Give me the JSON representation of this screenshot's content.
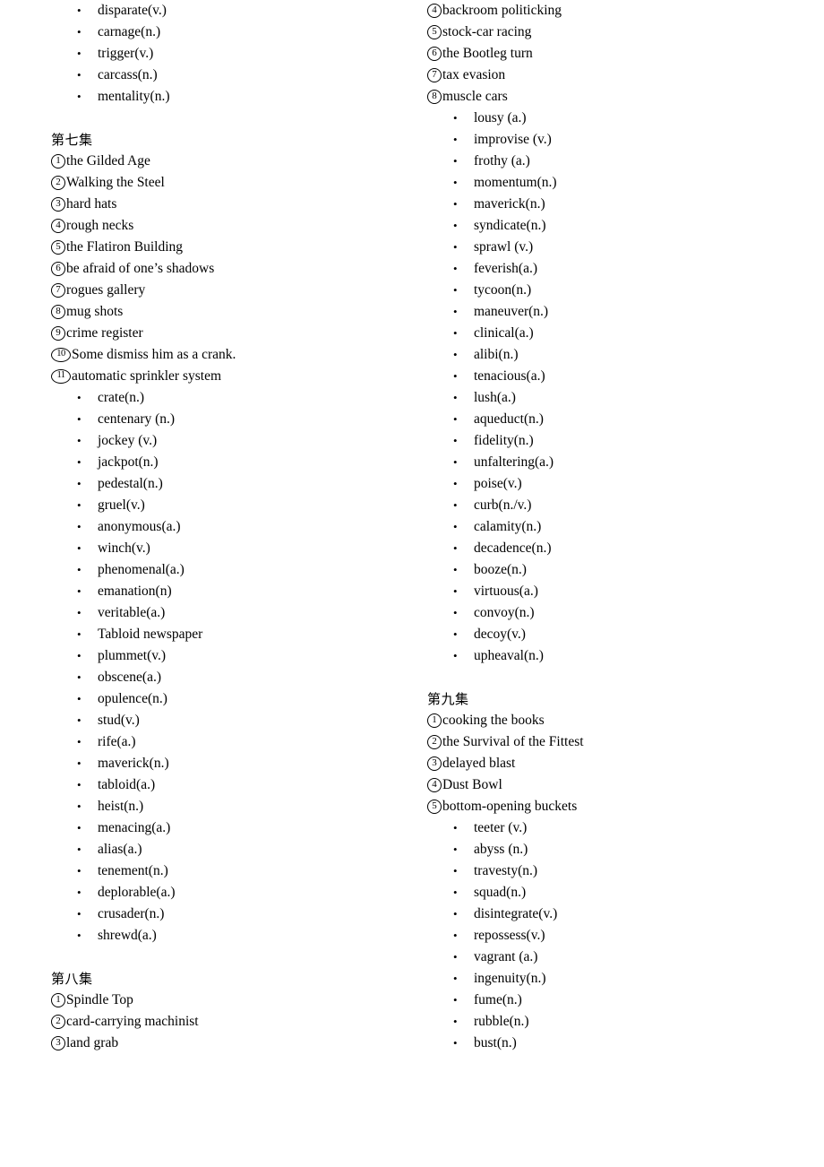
{
  "document": {
    "type": "vocabulary-list",
    "text_color": "#000000",
    "background_color": "#ffffff",
    "bullet_glyph": "•"
  },
  "columns": [
    {
      "name": "left-column",
      "blocks": [
        {
          "kind": "bullets",
          "items": [
            "disparate(v.)",
            "carnage(n.)",
            "trigger(v.)",
            "carcass(n.)",
            "mentality(n.)"
          ]
        },
        {
          "kind": "spacer"
        },
        {
          "kind": "heading",
          "text": "第七集"
        },
        {
          "kind": "numbered",
          "items": [
            {
              "marker": "1",
              "text": "the Gilded Age"
            },
            {
              "marker": "2",
              "text": "Walking the Steel"
            },
            {
              "marker": "3",
              "text": "hard hats"
            },
            {
              "marker": "4",
              "text": "rough necks"
            },
            {
              "marker": "5",
              "text": "the Flatiron Building"
            },
            {
              "marker": "6",
              "text": "be afraid of one’s shadows"
            },
            {
              "marker": "7",
              "text": "rogues gallery"
            },
            {
              "marker": "8",
              "text": "mug shots"
            },
            {
              "marker": "9",
              "text": "crime register"
            },
            {
              "marker": "10",
              "text": "Some dismiss him as a crank."
            },
            {
              "marker": "11",
              "text": "automatic sprinkler system"
            }
          ]
        },
        {
          "kind": "bullets",
          "items": [
            "crate(n.)",
            "centenary (n.)",
            "jockey (v.)",
            "jackpot(n.)",
            "pedestal(n.)",
            "gruel(v.)",
            "anonymous(a.)",
            "winch(v.)",
            "phenomenal(a.)",
            "emanation(n)",
            "veritable(a.)",
            "Tabloid newspaper",
            "plummet(v.)",
            "obscene(a.)",
            "opulence(n.)",
            "stud(v.)",
            "rife(a.)",
            "maverick(n.)",
            "tabloid(a.)",
            "heist(n.)",
            "menacing(a.)",
            "alias(a.)",
            "tenement(n.)",
            "deplorable(a.)",
            "crusader(n.)",
            "shrewd(a.)"
          ]
        },
        {
          "kind": "spacer"
        },
        {
          "kind": "heading",
          "text": "第八集"
        },
        {
          "kind": "numbered",
          "items": [
            {
              "marker": "1",
              "text": "Spindle Top"
            },
            {
              "marker": "2",
              "text": "card-carrying machinist"
            },
            {
              "marker": "3",
              "text": "land grab"
            }
          ]
        }
      ]
    },
    {
      "name": "right-column",
      "blocks": [
        {
          "kind": "numbered",
          "items": [
            {
              "marker": "4",
              "text": "backroom politicking"
            },
            {
              "marker": "5",
              "text": "stock-car racing"
            },
            {
              "marker": "6",
              "text": "the Bootleg turn"
            },
            {
              "marker": "7",
              "text": "tax evasion"
            },
            {
              "marker": "8",
              "text": "muscle cars"
            }
          ]
        },
        {
          "kind": "bullets",
          "items": [
            "lousy (a.)",
            "improvise (v.)",
            "frothy (a.)",
            "momentum(n.)",
            "maverick(n.)",
            "syndicate(n.)",
            "sprawl (v.)",
            "feverish(a.)",
            "tycoon(n.)",
            "maneuver(n.)",
            "clinical(a.)",
            "alibi(n.)",
            "tenacious(a.)",
            "lush(a.)",
            "aqueduct(n.)",
            "fidelity(n.)",
            "unfaltering(a.)",
            "poise(v.)",
            "curb(n./v.)",
            "calamity(n.)",
            "decadence(n.)",
            "booze(n.)",
            "virtuous(a.)",
            "convoy(n.)",
            "decoy(v.)",
            "upheaval(n.)"
          ]
        },
        {
          "kind": "spacer"
        },
        {
          "kind": "heading",
          "text": "第九集"
        },
        {
          "kind": "numbered",
          "items": [
            {
              "marker": "1",
              "text": "cooking the books"
            },
            {
              "marker": "2",
              "text": "the Survival of the Fittest"
            },
            {
              "marker": "3",
              "text": "delayed blast"
            },
            {
              "marker": "4",
              "text": "Dust Bowl"
            },
            {
              "marker": "5",
              "text": "bottom-opening buckets"
            }
          ]
        },
        {
          "kind": "bullets",
          "items": [
            "teeter (v.)",
            "abyss (n.)",
            "travesty(n.)",
            "squad(n.)",
            "disintegrate(v.)",
            "repossess(v.)",
            "vagrant (a.)",
            "ingenuity(n.)",
            "fume(n.)",
            "rubble(n.)",
            "bust(n.)"
          ]
        }
      ]
    }
  ]
}
